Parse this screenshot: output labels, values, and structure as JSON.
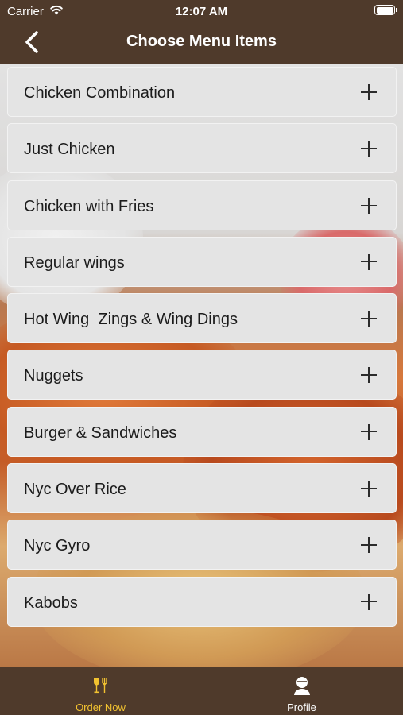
{
  "status_bar": {
    "carrier": "Carrier",
    "time": "12:07 AM",
    "wifi_icon": "wifi-icon",
    "battery_icon": "battery-icon"
  },
  "nav": {
    "title": "Choose Menu Items",
    "back_icon": "chevron-left-icon"
  },
  "menu": {
    "items": [
      {
        "label": "Chicken Combination",
        "icon": "plus-icon"
      },
      {
        "label": "Just Chicken",
        "icon": "plus-icon"
      },
      {
        "label": "Chicken with Fries",
        "icon": "plus-icon"
      },
      {
        "label": "Regular wings",
        "icon": "plus-icon"
      },
      {
        "label": "Hot Wing  Zings & Wing Dings",
        "icon": "plus-icon"
      },
      {
        "label": "Nuggets",
        "icon": "plus-icon"
      },
      {
        "label": "Burger & Sandwiches",
        "icon": "plus-icon"
      },
      {
        "label": "Nyc Over Rice",
        "icon": "plus-icon"
      },
      {
        "label": "Nyc Gyro",
        "icon": "plus-icon"
      },
      {
        "label": "Kabobs",
        "icon": "plus-icon"
      }
    ]
  },
  "tabbar": {
    "tabs": [
      {
        "label": "Order Now",
        "icon": "dining-icon",
        "active": true
      },
      {
        "label": "Profile",
        "icon": "person-icon",
        "active": false
      }
    ]
  },
  "colors": {
    "bar_background": "#4f3a2b",
    "active_tab": "#f2c230",
    "item_background": "#e4e4e4"
  }
}
